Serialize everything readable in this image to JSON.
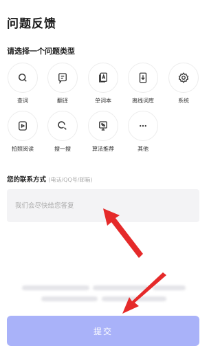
{
  "page": {
    "title": "问题反馈"
  },
  "category_section": {
    "label": "请选择一个问题类型"
  },
  "categories": [
    {
      "label": "查词",
      "icon": "search-icon"
    },
    {
      "label": "翻译",
      "icon": "translate-icon"
    },
    {
      "label": "单词本",
      "icon": "wordbook-icon"
    },
    {
      "label": "离线词库",
      "icon": "offline-dictionary-icon"
    },
    {
      "label": "系统",
      "icon": "settings-gear-icon"
    },
    {
      "label": "拍照阅读",
      "icon": "photo-reading-icon"
    },
    {
      "label": "搜一搜",
      "icon": "search-more-icon"
    },
    {
      "label": "算法推荐",
      "icon": "algorithm-recommend-icon"
    },
    {
      "label": "其他",
      "icon": "more-dots-icon"
    }
  ],
  "contact": {
    "label": "您的联系方式",
    "hint": "(电话/QQ号/邮箱)"
  },
  "feedback_input": {
    "placeholder": "我们会尽快给您答复"
  },
  "submit": {
    "label": "提交"
  },
  "colors": {
    "submit_bg": "#a9b2f9",
    "annotation_arrow": "#e52a2a"
  }
}
